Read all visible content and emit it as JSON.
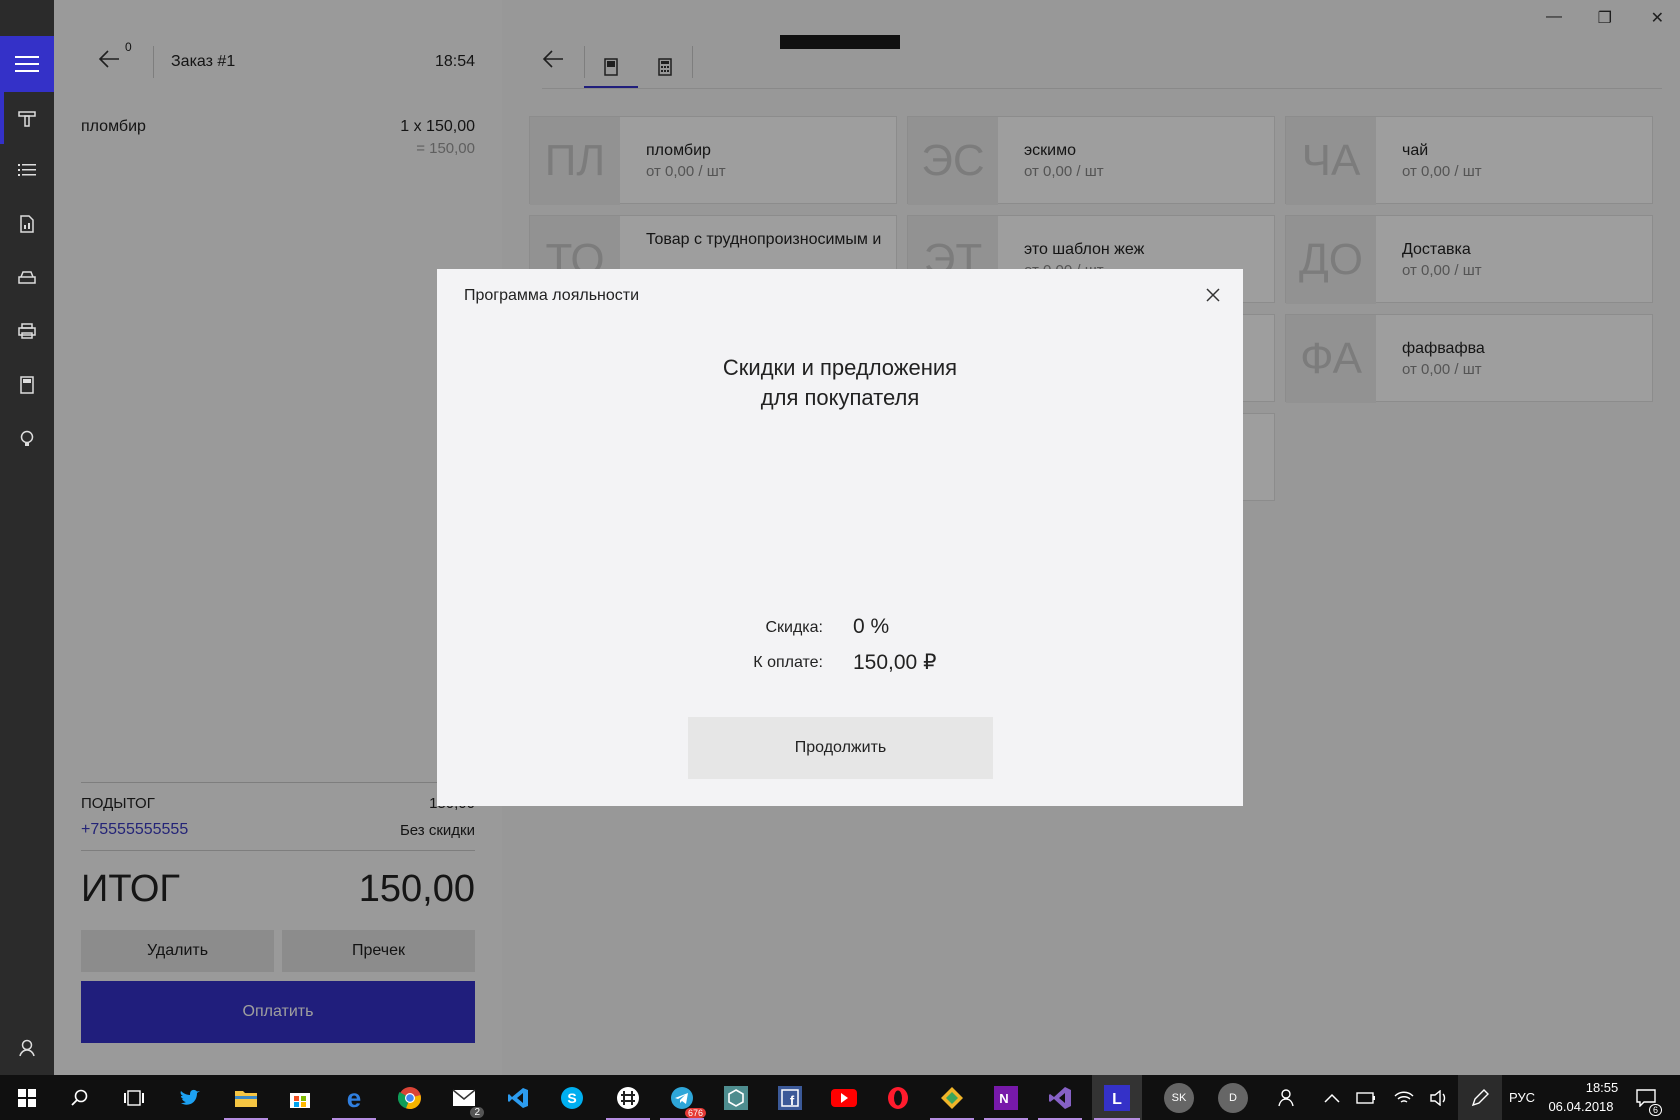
{
  "window": {
    "minimize_label": "—",
    "restore_label": "❐",
    "close_label": "✕"
  },
  "order": {
    "counter": "0",
    "title": "Заказ #1",
    "time": "18:54",
    "items": [
      {
        "name": "пломбир",
        "qty_price": "1 x 150,00",
        "sum": "= 150,00"
      }
    ],
    "subtotal_label": "ПОДЫТОГ",
    "subtotal_value": "150,00",
    "customer_phone": "+75555555555",
    "discount_status": "Без скидки",
    "total_label": "ИТОГ",
    "total_value": "150,00",
    "delete_label": "Удалить",
    "precheck_label": "Пречек",
    "pay_label": "Оплатить"
  },
  "catalog": {
    "tiles": [
      {
        "abbr": "ПЛ",
        "name": "пломбир",
        "price": "от 0,00 / шт"
      },
      {
        "abbr": "ЭС",
        "name": "эскимо",
        "price": "от 0,00 / шт"
      },
      {
        "abbr": "ЧА",
        "name": "чай",
        "price": "от 0,00 / шт"
      },
      {
        "abbr": "ТО",
        "name": "Товар с труднопроизносимым и",
        "price": ""
      },
      {
        "abbr": "ЭТ",
        "name": "это шаблон жеж",
        "price": "от 0,00 / шт"
      },
      {
        "abbr": "ДО",
        "name": "Доставка",
        "price": "от 0,00 / шт"
      },
      {
        "abbr": "ФА",
        "name": "фафвафва",
        "price": "от 0,00 / шт"
      }
    ]
  },
  "dialog": {
    "title": "Программа лояльности",
    "heading_line1": "Скидки и предложения",
    "heading_line2": "для покупателя",
    "discount_label": "Скидка:",
    "discount_value": "0 %",
    "to_pay_label": "К оплате:",
    "to_pay_value": "150,00 ₽",
    "continue_label": "Продолжить"
  },
  "taskbar": {
    "mail_badge": "2",
    "telegram_badge": "676",
    "avatar1": "SK",
    "avatar2": "D",
    "language": "РУС",
    "clock_time": "18:55",
    "clock_date": "06.04.2018",
    "notifications_badge": "6"
  },
  "colors": {
    "accent": "#3431c8",
    "rail": "#2b2b2b",
    "taskbar": "#101010",
    "phone_link": "#3b3bc0"
  }
}
